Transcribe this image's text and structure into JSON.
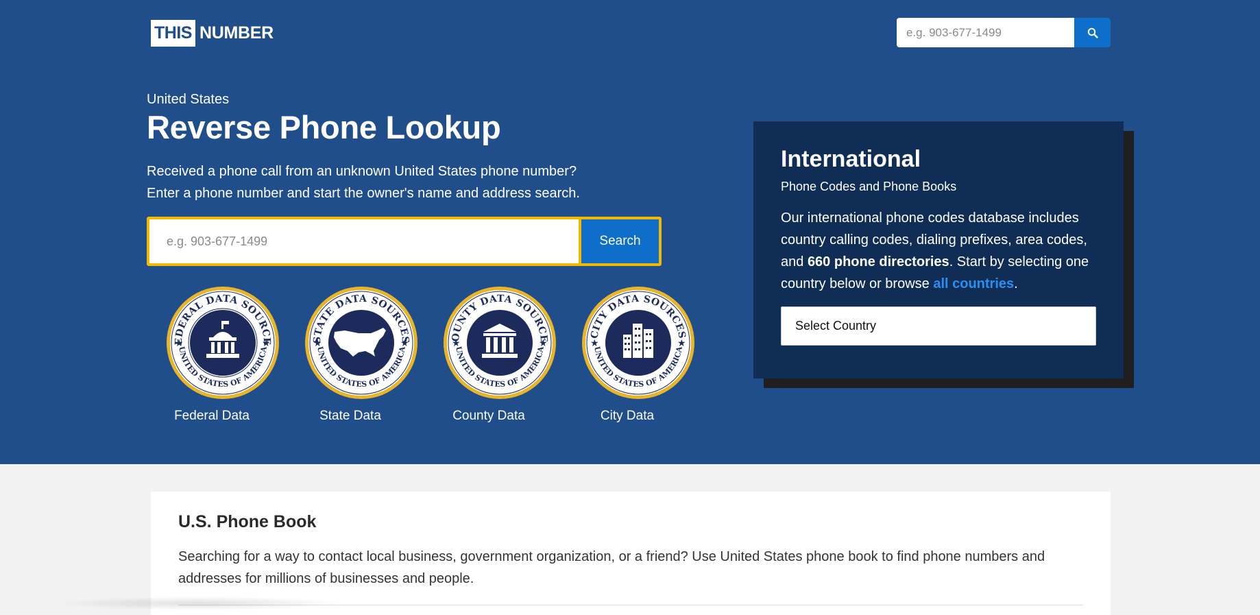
{
  "header": {
    "logo_this": "THIS",
    "logo_number": "NUMBER",
    "search_placeholder": "e.g. 903-677-1499"
  },
  "hero": {
    "country": "United States",
    "title": "Reverse Phone Lookup",
    "intro_line1": "Received a phone call from an unknown United States phone number?",
    "intro_line2": "Enter a phone number and start the owner's name and address search.",
    "search_placeholder": "e.g. 903-677-1499",
    "search_button": "Search",
    "seals": [
      {
        "label": "Federal Data",
        "top_text": "FEDERAL DATA SOURCES",
        "bottom_text": "UNITED STATES OF AMERICA",
        "icon": "capitol-icon"
      },
      {
        "label": "State Data",
        "top_text": "STATE DATA SOURCES",
        "bottom_text": "UNITED STATES OF AMERICA",
        "icon": "usa-map-icon"
      },
      {
        "label": "County Data",
        "top_text": "COUNTY DATA SOURCES",
        "bottom_text": "UNITED STATES OF AMERICA",
        "icon": "courthouse-icon"
      },
      {
        "label": "City Data",
        "top_text": "CITY DATA SOURCES",
        "bottom_text": "UNITED STATES OF AMERICA",
        "icon": "city-buildings-icon"
      }
    ]
  },
  "international": {
    "title": "International",
    "subtitle": "Phone Codes and Phone Books",
    "desc_part1": "Our international phone codes database includes country calling codes, dialing prefixes, area codes, and ",
    "desc_bold": "660 phone directories",
    "desc_part2": ". Start by selecting one country below or browse ",
    "desc_link": "all countries",
    "desc_part3": ".",
    "select_label": "Select Country"
  },
  "phonebook": {
    "title": "U.S. Phone Book",
    "text": "Searching for a way to contact local business, government organization, or a friend? Use United States phone book to find phone numbers and addresses for millions of businesses and people."
  },
  "colors": {
    "hero_bg": "#1f4e8a",
    "intl_bg": "#0f2d55",
    "accent_blue": "#0d6fca",
    "search_border": "#f5b800",
    "seal_gold": "#e8b52a",
    "seal_navy": "#1c2a5c"
  }
}
